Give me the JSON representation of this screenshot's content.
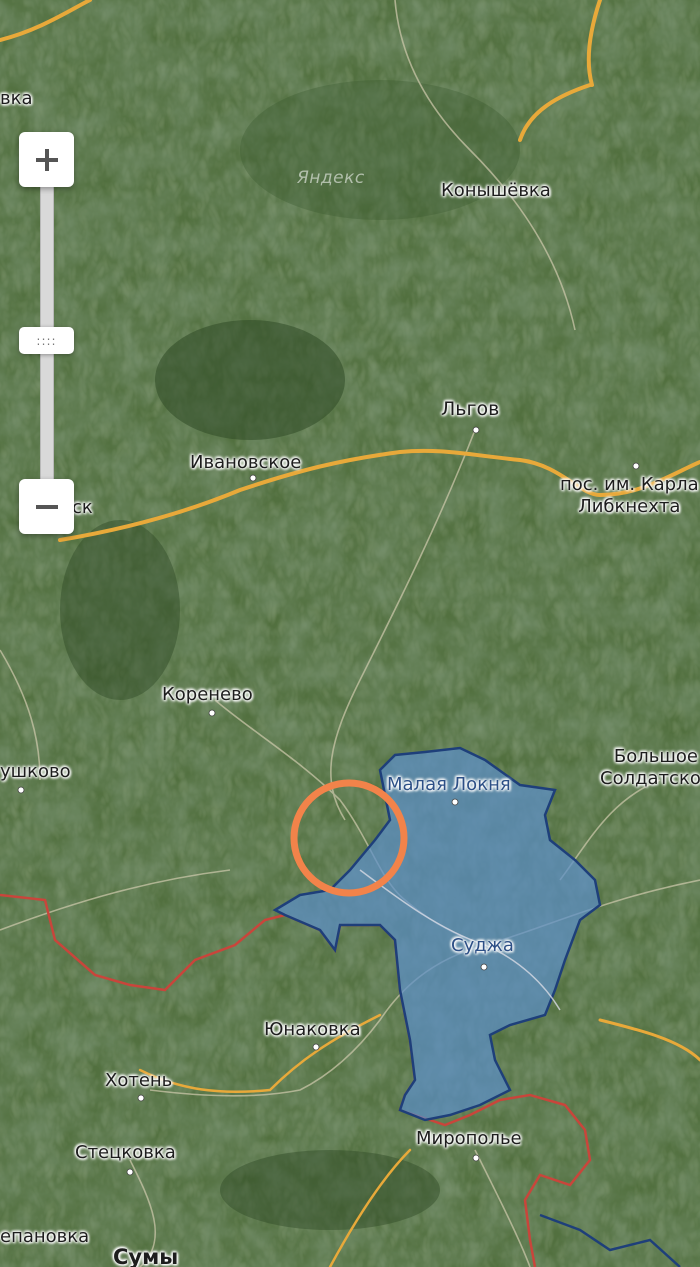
{
  "map": {
    "watermark": "Яндекс",
    "places": {
      "konyshevka": "Конышёвка",
      "lgov": "Льгов",
      "ivanovskoe": "Ивановское",
      "karl": "пос. им. Карла\nЛибкнехта",
      "rylsk": "Рыльск",
      "rylsk_visible": "ск",
      "vka": "вка",
      "korenevo": "Коренево",
      "bolshoe": "Большое\nСолдатское",
      "tetkino": "ушково",
      "malaya": "Малая Локня",
      "sudzha": "Суджа",
      "yunakovka": "Юнаковка",
      "khoten": "Хотень",
      "stetskovka": "Стецковка",
      "miropolye": "Миропольe",
      "stepanovka": "епановка",
      "sumy": "Сумы"
    },
    "colors": {
      "terrain": "#4c6a3f",
      "road": "#e8a93a",
      "controlled_area": "#5b8fc7",
      "controlled_border": "#1e3f7a",
      "state_border": "#c9453b",
      "marker": "#f2834a"
    }
  },
  "controls": {
    "zoom_in_icon": "plus-icon",
    "zoom_out_icon": "minus-icon",
    "slider_grip": "::::"
  }
}
